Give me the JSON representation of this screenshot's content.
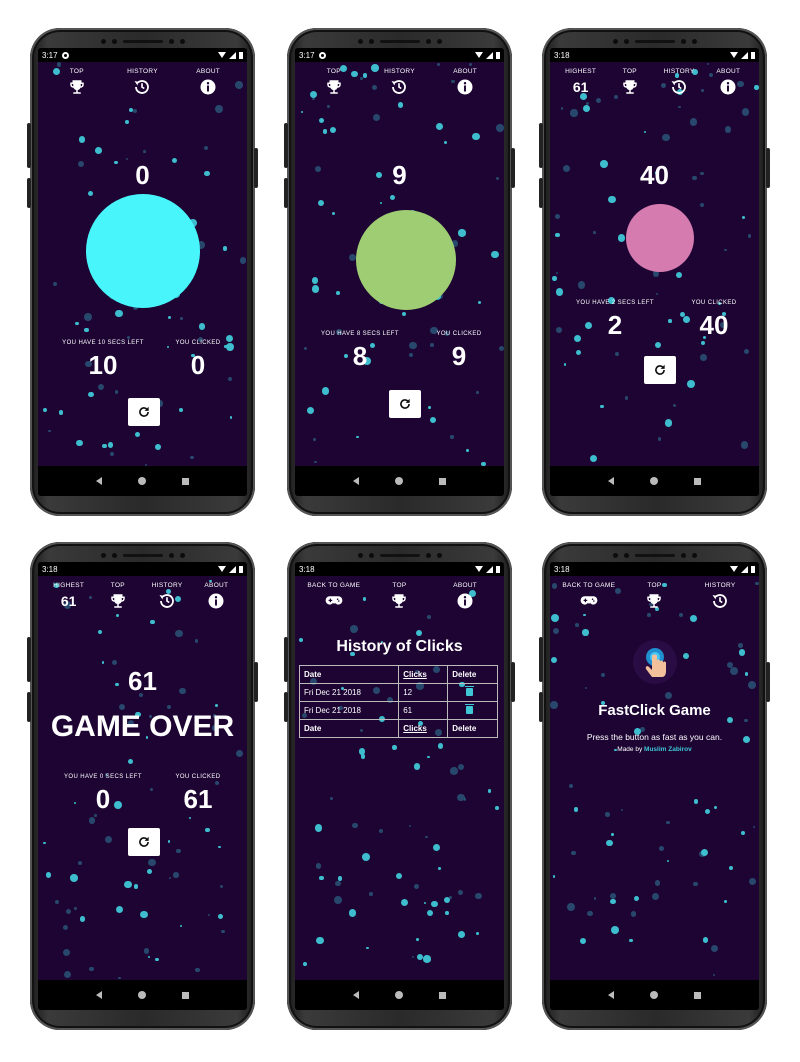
{
  "status": {
    "time_p1": "3:17",
    "time_p2": "3:17",
    "time_p3": "3:18",
    "time_p4": "3:18",
    "time_p5": "3:18",
    "time_p6": "3:18"
  },
  "colors": {
    "background": "#1d0433",
    "dot_teal": "#3fc7d6",
    "circle_cyan": "#48f5fb",
    "circle_green": "#9ecd73",
    "circle_pink": "#d67bb0",
    "trash": "#3fc7d6"
  },
  "nav": {
    "top": "TOP",
    "history": "HISTORY",
    "about": "ABOUT",
    "highest": "HIGHEST",
    "back_to_game": "BACK TO GAME"
  },
  "screen1": {
    "count": "0",
    "secs_left_label": "YOU HAVE 10 SECS LEFT",
    "clicked_label": "YOU CLICKED",
    "secs_left": "10",
    "clicked": "0",
    "circle_color": "#48f5fb"
  },
  "screen2": {
    "count": "9",
    "secs_left_label": "YOU HAVE 8 SECS LEFT",
    "clicked_label": "YOU CLICKED",
    "secs_left": "8",
    "clicked": "9",
    "circle_color": "#9ecd73"
  },
  "screen3": {
    "highest": "61",
    "count": "40",
    "secs_left_label": "YOU HAVE 2 SECS LEFT",
    "clicked_label": "YOU CLICKED",
    "secs_left": "2",
    "clicked": "40",
    "circle_color": "#d67bb0"
  },
  "screen4": {
    "highest": "61",
    "count": "61",
    "game_over": "GAME OVER",
    "secs_left_label": "YOU HAVE 0 SECS LEFT",
    "clicked_label": "YOU CLICKED",
    "secs_left": "0",
    "clicked": "61"
  },
  "screen5": {
    "title": "History of Clicks",
    "headers": [
      "Date",
      "Clicks",
      "Delete"
    ],
    "rows": [
      {
        "date": "Fri Dec 21 2018",
        "clicks": "12"
      },
      {
        "date": "Fri Dec 21 2018",
        "clicks": "61"
      }
    ]
  },
  "screen6": {
    "title": "FastClick Game",
    "description": "Press the button as fast as you can.",
    "made_by": "Made by",
    "author": "Muslim Zabirov"
  }
}
